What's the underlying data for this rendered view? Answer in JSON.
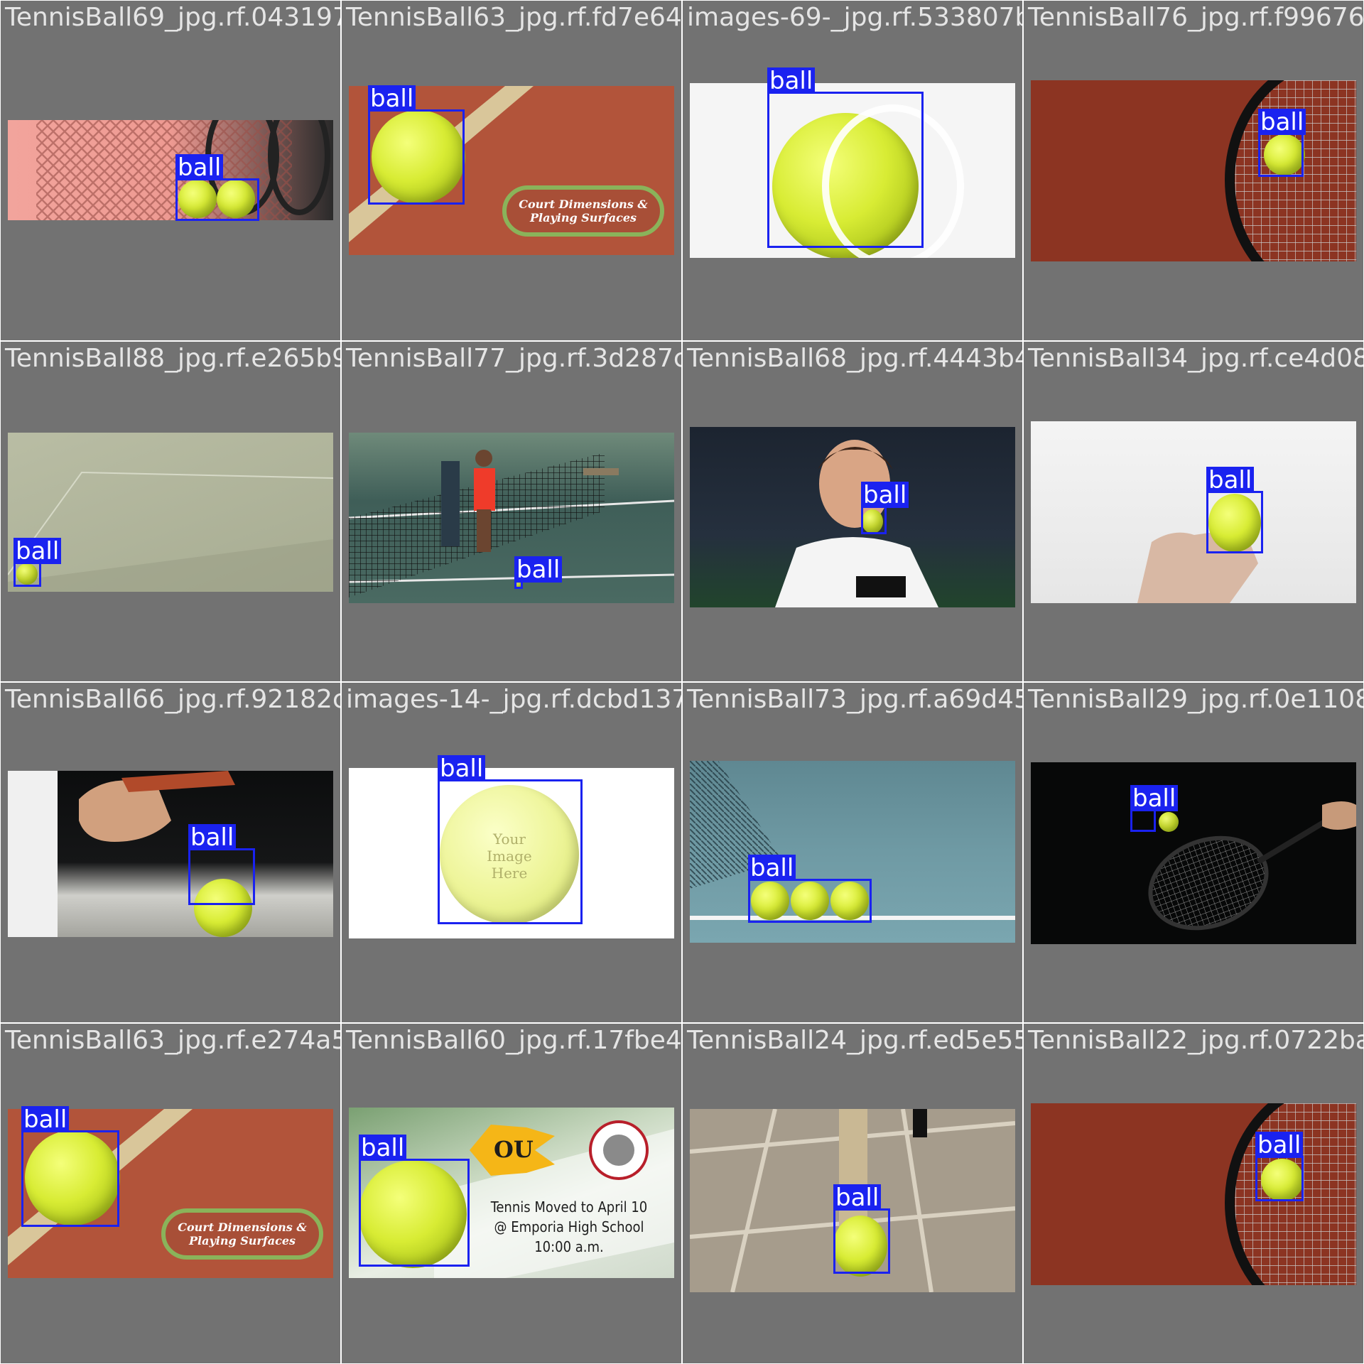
{
  "label_color": "#1a22f0",
  "tile_background": "#727272",
  "tiles": [
    {
      "filename": "TennisBall69_jpg.rf.0431979196773282636",
      "boxes": [
        {
          "label": "ball"
        }
      ]
    },
    {
      "filename": "TennisBall63_jpg.rf.fd7e6487704ad909b155",
      "boxes": [
        {
          "label": "ball"
        }
      ],
      "caption": [
        "Court Dimensions &",
        "Playing Surfaces"
      ]
    },
    {
      "filename": "images-69-_jpg.rf.533807b44dae42b2761a674",
      "boxes": [
        {
          "label": "ball"
        }
      ]
    },
    {
      "filename": "TennisBall76_jpg.rf.f99676e0",
      "boxes": [
        {
          "label": "ball"
        }
      ]
    },
    {
      "filename": "TennisBall88_jpg.rf.e265b95c35a3874d753e",
      "boxes": [
        {
          "label": "ball"
        }
      ]
    },
    {
      "filename": "TennisBall77_jpg.rf.3d287cfba77e2390698",
      "boxes": [
        {
          "label": "ball"
        }
      ]
    },
    {
      "filename": "TennisBall68_jpg.rf.4443b4e6e813b7d4f7",
      "boxes": [
        {
          "label": "ball"
        }
      ]
    },
    {
      "filename": "TennisBall34_jpg.rf.ce4d08a",
      "boxes": [
        {
          "label": "ball"
        }
      ]
    },
    {
      "filename": "TennisBall66_jpg.rf.92182cca584ff1f4-bc",
      "boxes": [
        {
          "label": "ball"
        }
      ]
    },
    {
      "filename": "images-14-_jpg.rf.dcbd1379031708341673142",
      "boxes": [
        {
          "label": "ball"
        }
      ],
      "ball_text": [
        "Your",
        "Image",
        "Here"
      ]
    },
    {
      "filename": "TennisBall73_jpg.rf.a69d452de2b7032d297a",
      "boxes": [
        {
          "label": "ball"
        }
      ]
    },
    {
      "filename": "TennisBall29_jpg.rf.0e11083",
      "boxes": [
        {
          "label": "ball"
        }
      ]
    },
    {
      "filename": "TennisBall63_jpg.rf.e274a5fde9812b0d5967",
      "boxes": [
        {
          "label": "ball"
        }
      ],
      "caption": [
        "Court Dimensions &",
        "Playing Surfaces"
      ]
    },
    {
      "filename": "TennisBall60_jpg.rf.17fbe4b9db9d4a8742a",
      "boxes": [
        {
          "label": "ball"
        }
      ],
      "flyer": [
        "Tennis Moved to April 10",
        "@ Emporia High School",
        "10:00 a.m."
      ],
      "logo_text": "OU"
    },
    {
      "filename": "TennisBall24_jpg.rf.ed5e5543060e183e612",
      "boxes": [
        {
          "label": "ball"
        }
      ]
    },
    {
      "filename": "TennisBall22_jpg.rf.0722ba0",
      "boxes": [
        {
          "label": "ball"
        }
      ]
    }
  ]
}
